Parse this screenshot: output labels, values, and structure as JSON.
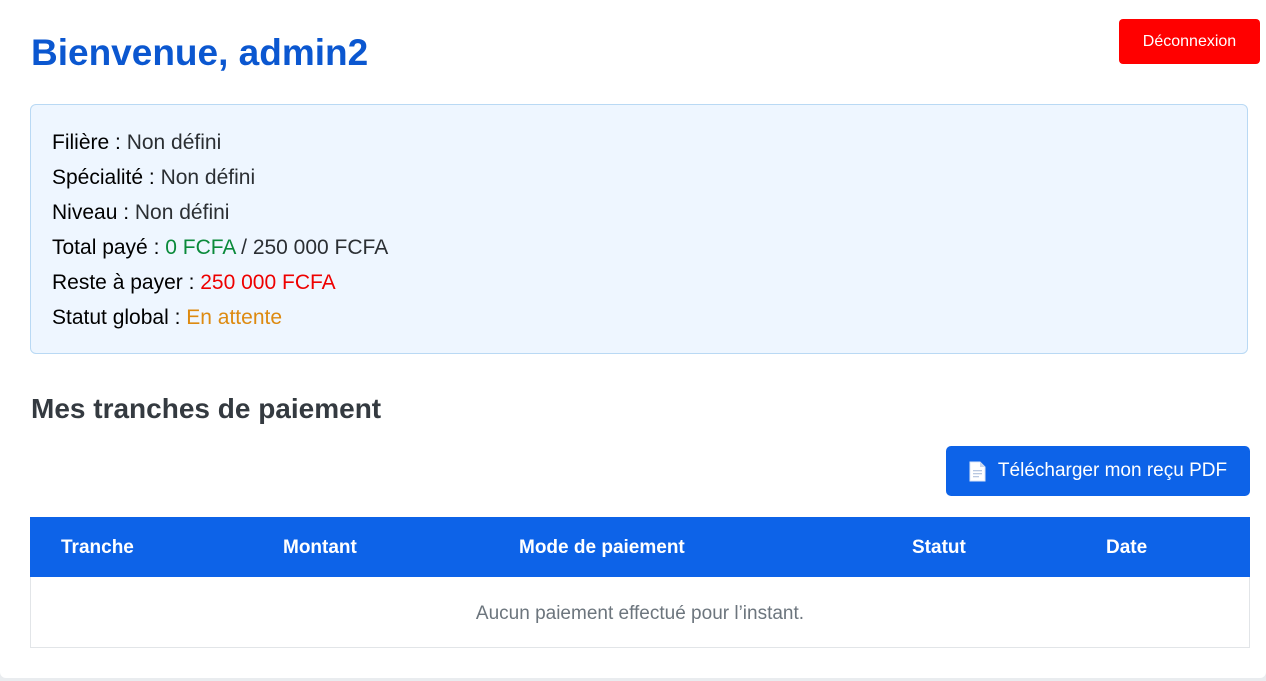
{
  "header": {
    "welcome": "Bienvenue, admin2",
    "logout_label": "Déconnexion"
  },
  "info": {
    "filiere_label": "Filière :",
    "filiere_value": "Non défini",
    "specialite_label": "Spécialité :",
    "specialite_value": "Non défini",
    "niveau_label": "Niveau :",
    "niveau_value": "Non défini",
    "total_label": "Total payé :",
    "total_paid": "0 FCFA",
    "total_separator": "/",
    "total_due": "250 000 FCFA",
    "reste_label": "Reste à payer :",
    "reste_value": "250 000 FCFA",
    "statut_label": "Statut global :",
    "statut_value": "En attente"
  },
  "payments": {
    "title": "Mes tranches de paiement",
    "download_label": "Télécharger mon reçu PDF",
    "download_icon": "document-icon",
    "columns": [
      "Tranche",
      "Montant",
      "Mode de paiement",
      "Statut",
      "Date"
    ],
    "empty_message": "Aucun paiement effectué pour l’instant."
  },
  "colors": {
    "title_blue": "#0b57d0",
    "primary": "#0d63e8",
    "danger": "#ff0000",
    "paid_green": "#0a8a3a",
    "due_red": "#ee0000",
    "pending_orange": "#dd8a10"
  }
}
